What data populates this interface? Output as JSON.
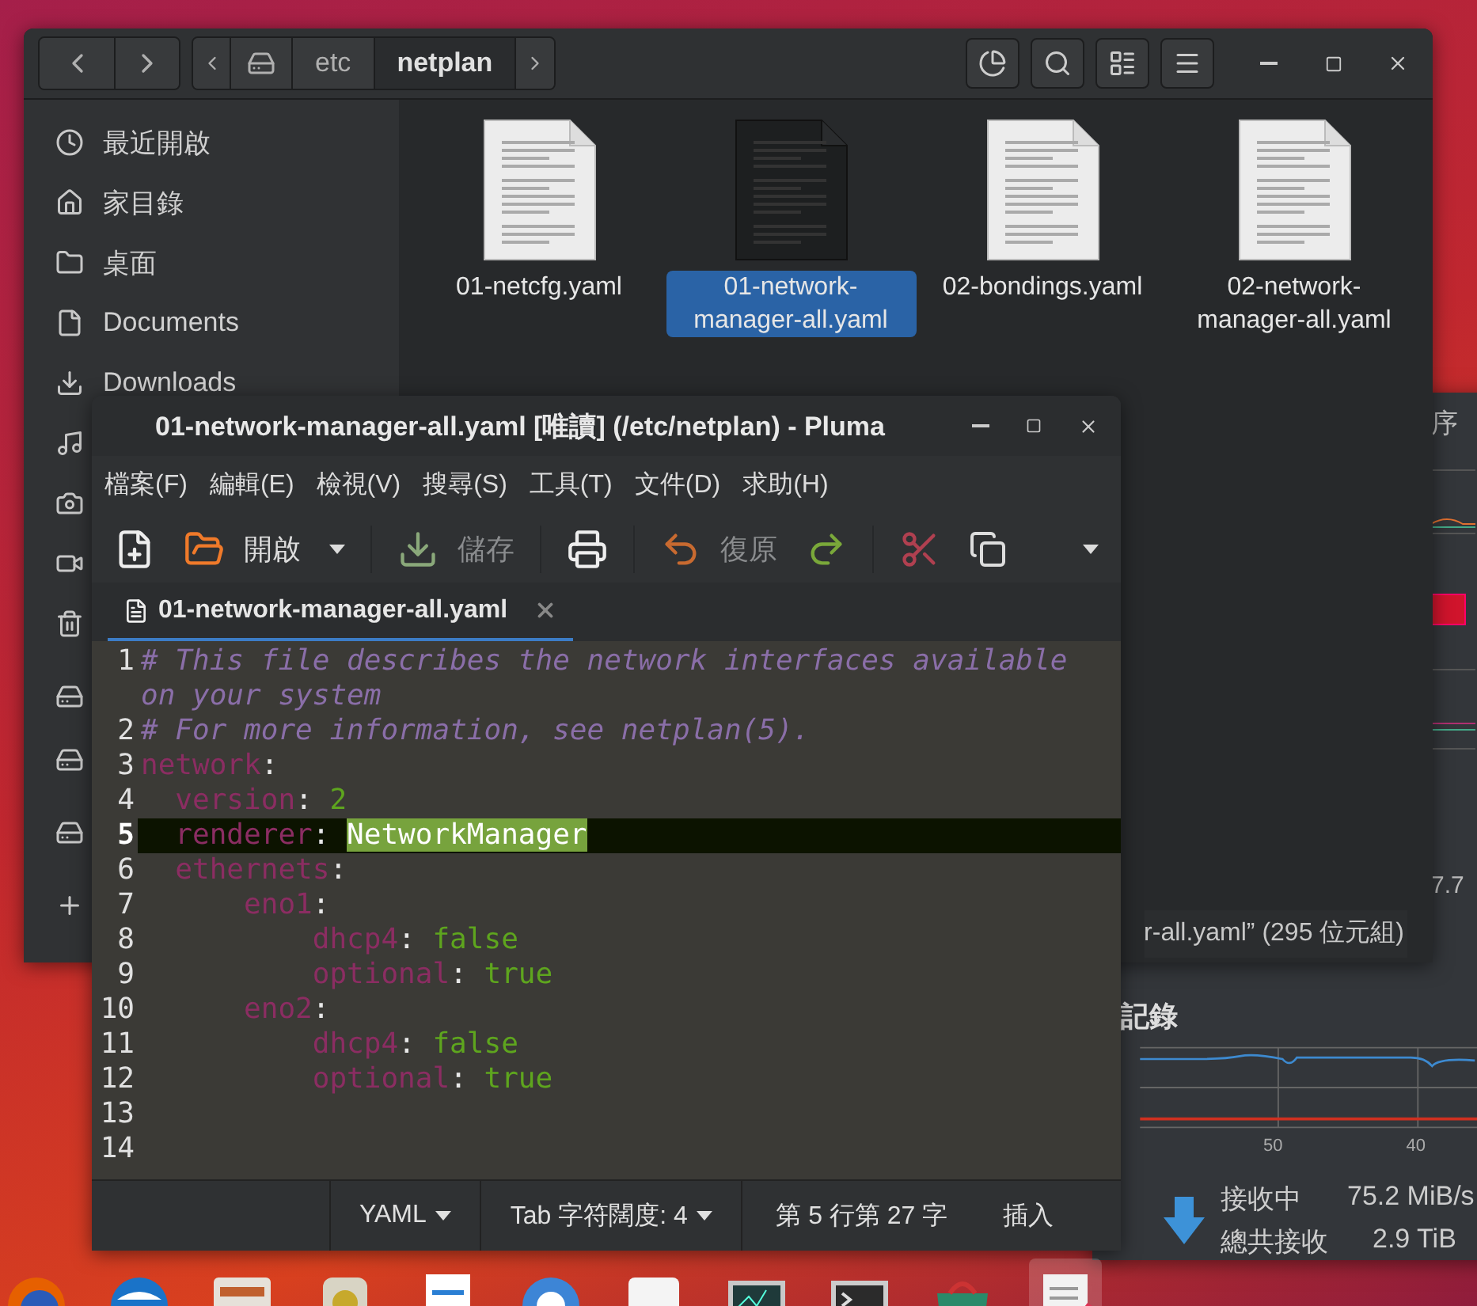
{
  "file_manager": {
    "path": [
      {
        "label": "etc",
        "selected": false
      },
      {
        "label": "netplan",
        "selected": true
      }
    ],
    "sidebar": {
      "items": [
        {
          "label": "最近開啟"
        },
        {
          "label": "家目錄"
        },
        {
          "label": "桌面"
        },
        {
          "label": "Documents"
        },
        {
          "label": "Downloads"
        }
      ]
    },
    "files": [
      {
        "name": "01-netcfg.yaml",
        "selected": false
      },
      {
        "name": "01-network-manager-all.yaml",
        "selected": true
      },
      {
        "name": "02-bondings.yaml",
        "selected": false
      },
      {
        "name": "02-network-manager-all.yaml",
        "selected": false
      }
    ],
    "status": "r-all.yaml” (295 位元組)"
  },
  "system_monitor": {
    "tab_fragment": "序",
    "value_fragment": "7.7",
    "section_title": "記錄",
    "x_ticks": [
      "50",
      "40"
    ],
    "rows": [
      {
        "label": "接收中",
        "value": "75.2 MiB/s"
      },
      {
        "label": "總共接收",
        "value": "2.9 TiB"
      }
    ]
  },
  "editor": {
    "title": "01-network-manager-all.yaml [唯讀] (/etc/netplan) - Pluma",
    "menus": [
      "檔案(F)",
      "編輯(E)",
      "檢視(V)",
      "搜尋(S)",
      "工具(T)",
      "文件(D)",
      "求助(H)"
    ],
    "toolbar": [
      {
        "kind": "new"
      },
      {
        "kind": "open",
        "label": "開啟",
        "disabled": false
      },
      {
        "kind": "dropdown"
      },
      {
        "kind": "separator"
      },
      {
        "kind": "save",
        "label": "儲存",
        "disabled": true
      },
      {
        "kind": "separator"
      },
      {
        "kind": "print"
      },
      {
        "kind": "separator"
      },
      {
        "kind": "undo",
        "label": "復原",
        "disabled": true
      },
      {
        "kind": "redo"
      },
      {
        "kind": "separator"
      },
      {
        "kind": "cut"
      },
      {
        "kind": "copy"
      },
      {
        "kind": "overflow"
      }
    ],
    "tabs": [
      {
        "label": "01-network-manager-all.yaml",
        "selected": true
      }
    ],
    "lines": [
      {
        "number": "1",
        "current": false,
        "tokens": [
          {
            "kind": "comment",
            "text": "# This file describes the network interfaces available on your system"
          }
        ]
      },
      {
        "number": "2",
        "current": false,
        "tokens": [
          {
            "kind": "comment",
            "text": "# For more information, see netplan(5)."
          }
        ]
      },
      {
        "number": "3",
        "current": false,
        "tokens": [
          {
            "kind": "key",
            "text": "network"
          },
          {
            "kind": "punct",
            "text": ":"
          }
        ]
      },
      {
        "number": "4",
        "current": false,
        "tokens": [
          {
            "kind": "key",
            "text": "  version"
          },
          {
            "kind": "punct",
            "text": ":"
          },
          {
            "kind": "value",
            "text": "2"
          }
        ]
      },
      {
        "number": "5",
        "current": true,
        "tokens": [
          {
            "kind": "key",
            "text": "  renderer"
          },
          {
            "kind": "punct",
            "text": ":"
          },
          {
            "kind": "selection",
            "text": "NetworkManager"
          }
        ]
      },
      {
        "number": "6",
        "current": false,
        "tokens": [
          {
            "kind": "key",
            "text": "  ethernets"
          },
          {
            "kind": "punct",
            "text": ":"
          }
        ]
      },
      {
        "number": "7",
        "current": false,
        "tokens": [
          {
            "kind": "key",
            "text": "      eno1"
          },
          {
            "kind": "punct",
            "text": ":"
          }
        ]
      },
      {
        "number": "8",
        "current": false,
        "tokens": [
          {
            "kind": "key",
            "text": "          dhcp4"
          },
          {
            "kind": "punct",
            "text": ":"
          },
          {
            "kind": "value",
            "text": "false"
          }
        ]
      },
      {
        "number": "9",
        "current": false,
        "tokens": [
          {
            "kind": "key",
            "text": "          optional"
          },
          {
            "kind": "punct",
            "text": ":"
          },
          {
            "kind": "value",
            "text": "true"
          }
        ]
      },
      {
        "number": "10",
        "current": false,
        "tokens": [
          {
            "kind": "key",
            "text": "      eno2"
          },
          {
            "kind": "punct",
            "text": ":"
          }
        ]
      },
      {
        "number": "11",
        "current": false,
        "tokens": [
          {
            "kind": "key",
            "text": "          dhcp4"
          },
          {
            "kind": "punct",
            "text": ":"
          },
          {
            "kind": "value",
            "text": "false"
          }
        ]
      },
      {
        "number": "12",
        "current": false,
        "tokens": [
          {
            "kind": "key",
            "text": "          optional"
          },
          {
            "kind": "punct",
            "text": ":"
          },
          {
            "kind": "value",
            "text": "true"
          }
        ]
      },
      {
        "number": "13",
        "current": false
      },
      {
        "number": "14",
        "current": false
      }
    ],
    "status": {
      "language": "YAML",
      "tab_width": "Tab 字符闊度: 4",
      "position": "第 5 行第 27 字",
      "mode": "插入"
    }
  },
  "launcher": [
    {
      "kind": "browser",
      "selected": false
    },
    {
      "kind": "mail",
      "selected": false
    },
    {
      "kind": "files",
      "selected": false
    },
    {
      "kind": "audio",
      "selected": false
    },
    {
      "kind": "writer",
      "selected": false
    },
    {
      "kind": "help",
      "selected": false
    },
    {
      "kind": "store",
      "selected": false
    },
    {
      "kind": "monitor",
      "selected": false
    },
    {
      "kind": "terminal",
      "selected": false
    },
    {
      "kind": "software",
      "selected": false
    },
    {
      "kind": "texteditor",
      "selected": true
    }
  ]
}
